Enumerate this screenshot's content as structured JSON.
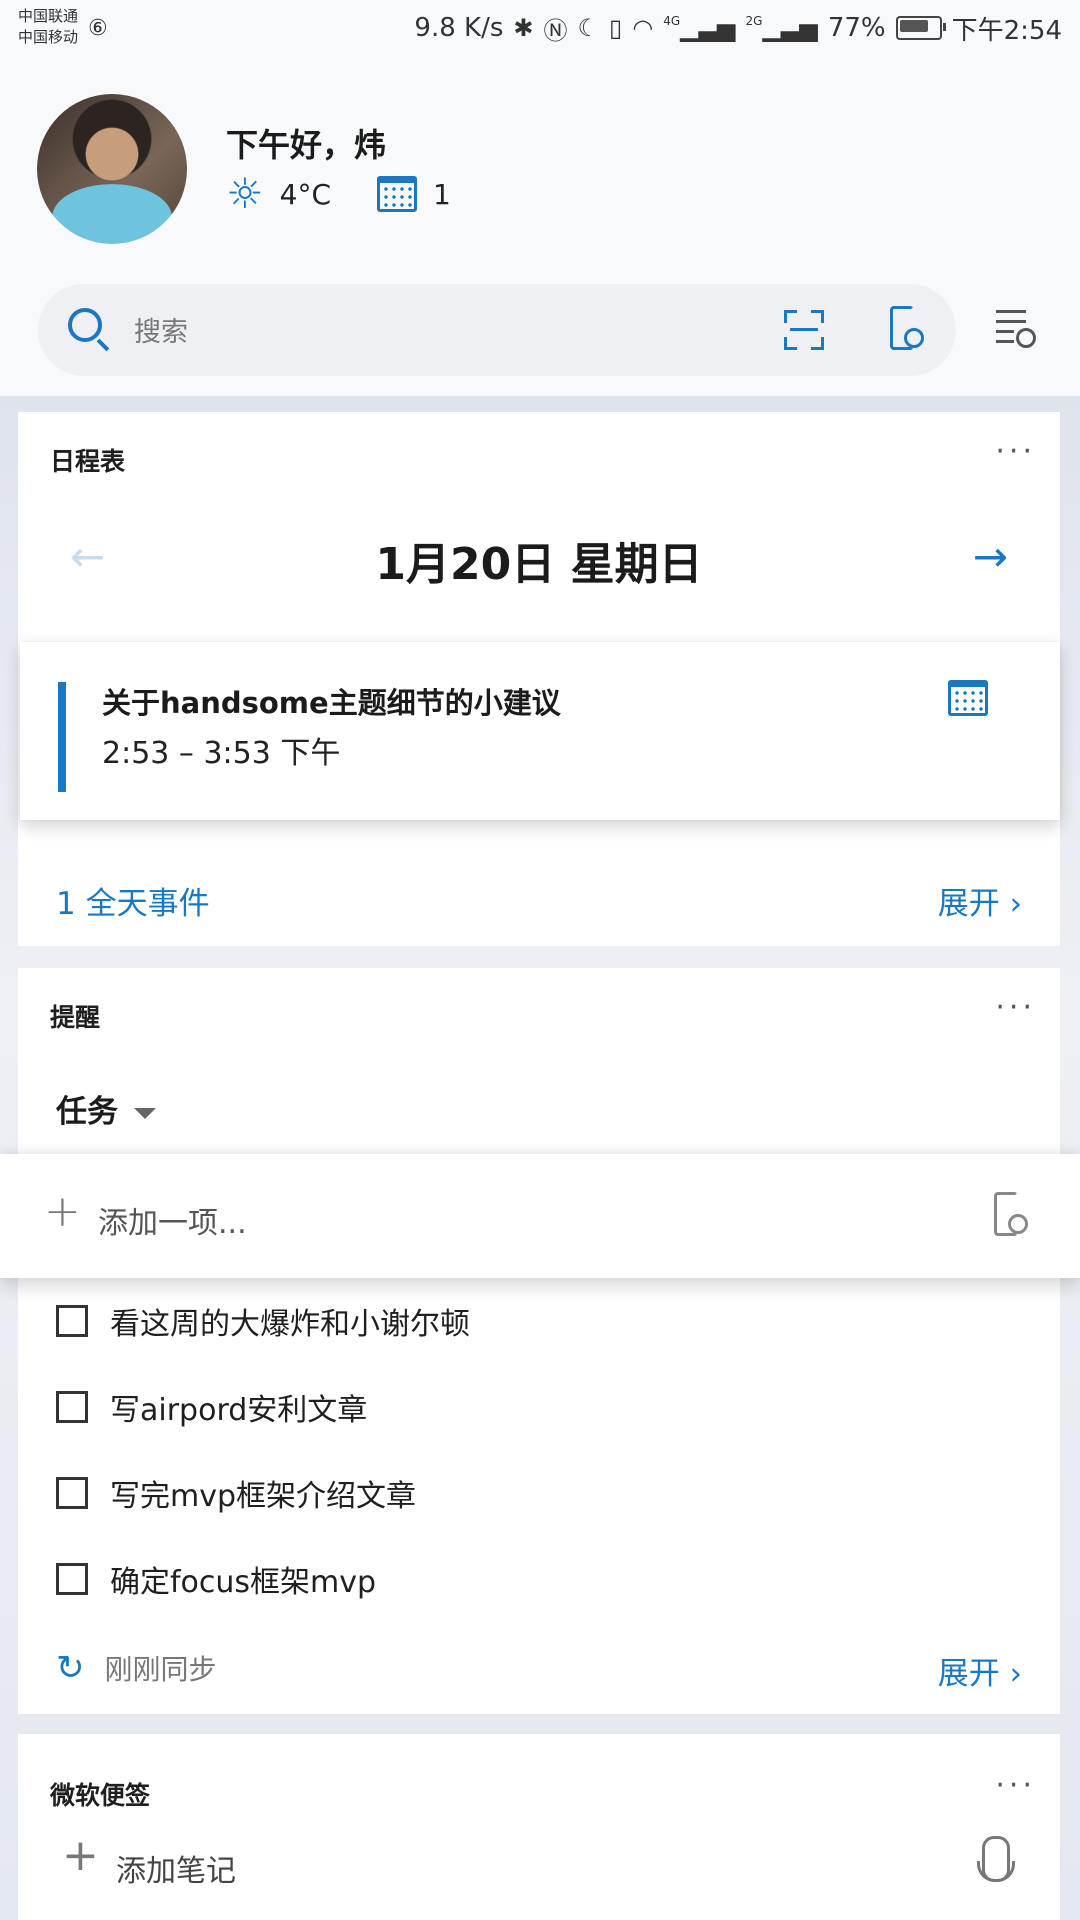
{
  "status_bar": {
    "carrier_1": "中国联通",
    "carrier_2": "中国移动",
    "speed": "9.8 K/s",
    "net_4g": "4G",
    "net_2g": "2G",
    "battery": "77%",
    "time": "下午2:54"
  },
  "header": {
    "greeting": "下午好，炜",
    "temperature": "4°C",
    "calendar_count": "1"
  },
  "search": {
    "placeholder": "搜索"
  },
  "calendar_card": {
    "title": "日程表",
    "more": "···",
    "date": "1月20日 星期日",
    "prev_arrow": "←",
    "next_arrow": "→",
    "event": {
      "title": "关于handsome主题细节的小建议",
      "time": "2:53  –  3:53 下午"
    },
    "all_day": "1 全天事件",
    "expand": "展开 ›"
  },
  "reminders_card": {
    "title": "提醒",
    "more": "···",
    "filter": "任务",
    "add_placeholder": "添加一项...",
    "tasks": [
      "看这周的大爆炸和小谢尔顿",
      "写airpord安利文章",
      "写完mvp框架介绍文章",
      "确定focus框架mvp"
    ],
    "sync_status": "刚刚同步",
    "expand": "展开 ›"
  },
  "notes_card": {
    "title": "微软便签",
    "more": "···",
    "add_note": "添加笔记"
  },
  "colors": {
    "accent": "#1a78c2",
    "card": "#ffffff",
    "header_bg": "#f7f9fb"
  }
}
